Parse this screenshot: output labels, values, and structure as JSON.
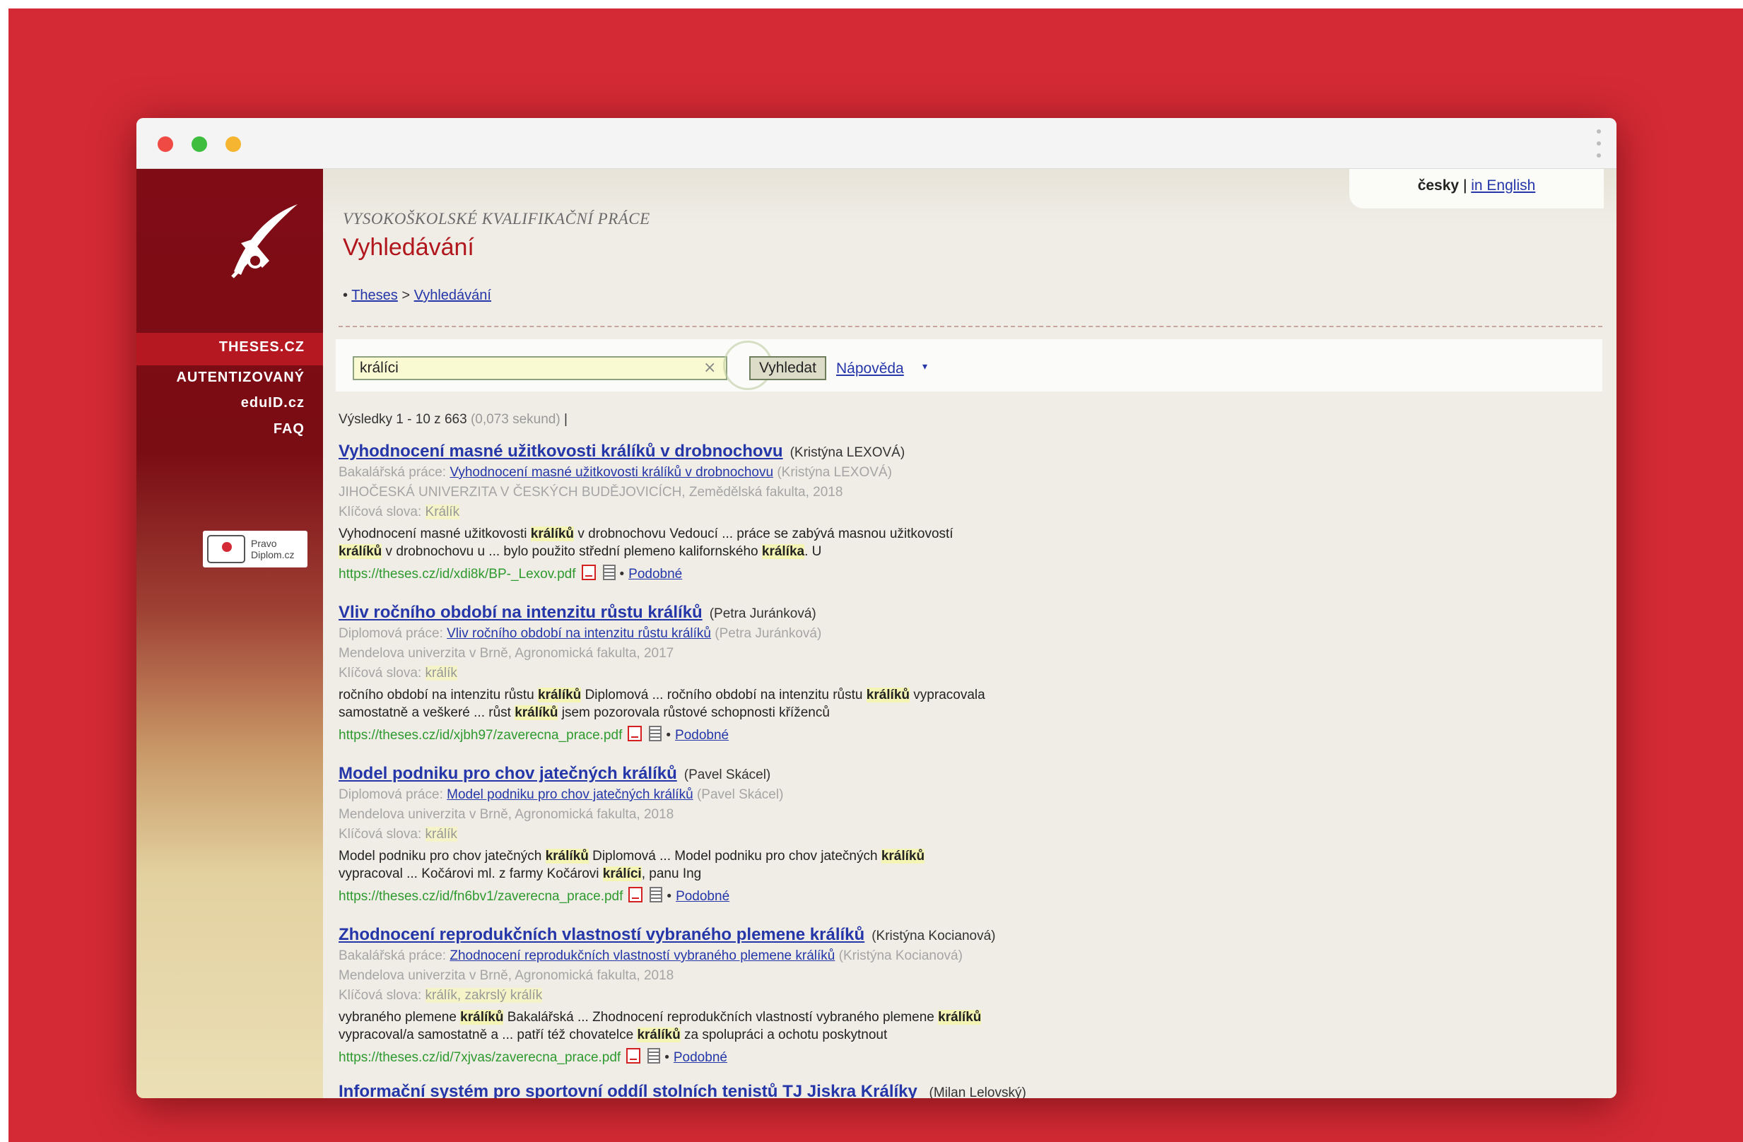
{
  "colors": {
    "background": "#d42a35",
    "sidebar_top": "#800c16",
    "accent": "#b1161d",
    "link": "#2436a8",
    "url": "#2f9a2f"
  },
  "lang": {
    "current": "česky",
    "separator": "|",
    "english": "in English"
  },
  "header": {
    "subtitle": "VYSOKOŠKOLSKÉ KVALIFIKAČNÍ PRÁCE",
    "title": "Vyhledávání"
  },
  "breadcrumb": {
    "bullet": "•",
    "home": "Theses",
    "sep": ">",
    "current": "Vyhledávání"
  },
  "sidebar": {
    "items": [
      {
        "label": "THESES.CZ",
        "active": true
      },
      {
        "label": "AUTENTIZOVANÝ"
      },
      {
        "label": "eduID.cz"
      },
      {
        "label": "FAQ"
      }
    ],
    "badge": {
      "line1": "Pravo",
      "line2": "Diplom.cz"
    }
  },
  "search": {
    "value": "králíci",
    "clear": "×",
    "button": "Vyhledat",
    "help": "Nápověda",
    "help_arrow": "▾"
  },
  "stats": {
    "text": "Výsledky 1 - 10 z 663",
    "time": "(0,073 sekund)",
    "tail": "|"
  },
  "results": [
    {
      "title": "Vyhodnocení masné užitkovosti králíků v drobnochovu",
      "author": "(Kristýna LEXOVÁ)",
      "type": "Bakalářská práce:",
      "type_link": "Vyhodnocení masné užitkovosti králíků v drobnochovu",
      "type_author": "(Kristýna LEXOVÁ)",
      "institution": "JIHOČESKÁ UNIVERZITA V ČESKÝCH BUDĚJOVICÍCH, Zemědělská fakulta, 2018",
      "keywords_label": "Klíčová slova:",
      "keywords": "Králík",
      "snippet1": "Vyhodnocení masné užitkovosti <b>králíků</b> v drobnochovu Vedoucí ... práce se zabývá masnou užitkovostí",
      "snippet2": "<b>králíků</b> v drobnochovu u ... bylo použito střední plemeno kalifornského <b>králíka</b>. U",
      "url": "https://theses.cz/id/xdi8k/BP-_Lexov.pdf",
      "similar": "Podobné"
    },
    {
      "title": "Vliv ročního období na intenzitu růstu králíků",
      "author": "(Petra Juránková)",
      "type": "Diplomová práce:",
      "type_link": "Vliv ročního období na intenzitu růstu králíků",
      "type_author": "(Petra Juránková)",
      "institution": "Mendelova univerzita v Brně, Agronomická fakulta, 2017",
      "keywords_label": "Klíčová slova:",
      "keywords": "králík",
      "snippet1": "ročního období na intenzitu růstu <b>králíků</b> Diplomová ... ročního období na intenzitu růstu <b>králíků</b> vypracovala",
      "snippet2": "samostatně a veškeré ... růst <b>králíků</b> jsem pozorovala růstové schopnosti kříženců",
      "url": "https://theses.cz/id/xjbh97/zaverecna_prace.pdf",
      "similar": "Podobné"
    },
    {
      "title": "Model podniku pro chov jatečných králíků",
      "author": "(Pavel Skácel)",
      "type": "Diplomová práce:",
      "type_link": "Model podniku pro chov jatečných králíků",
      "type_author": "(Pavel Skácel)",
      "institution": "Mendelova univerzita v Brně, Agronomická fakulta, 2018",
      "keywords_label": "Klíčová slova:",
      "keywords": "králík",
      "snippet1": "Model podniku pro chov jatečných <b>králíků</b> Diplomová ... Model podniku pro chov jatečných <b>králíků</b>",
      "snippet2": "vypracoval ... Kočárovi ml. z farmy Kočárovi <b>králíci</b>, panu Ing",
      "url": "https://theses.cz/id/fn6bv1/zaverecna_prace.pdf",
      "similar": "Podobné"
    },
    {
      "title": "Zhodnocení reprodukčních vlastností vybraného plemene králíků",
      "author": "(Kristýna Kocianová)",
      "type": "Bakalářská práce:",
      "type_link": "Zhodnocení reprodukčních vlastností vybraného plemene králíků",
      "type_author": "(Kristýna Kocianová)",
      "institution": "Mendelova univerzita v Brně, Agronomická fakulta, 2018",
      "keywords_label": "Klíčová slova:",
      "keywords": "králík, zakrslý králík",
      "snippet1": "vybraného plemene <b>králíků</b> Bakalářská ... Zhodnocení reprodukčních vlastností vybraného plemene <b>králíků</b>",
      "snippet2": "vypracoval/a samostatně a ... patří též chovatelce <b>králíků</b> za spolupráci a ochotu poskytnout",
      "url": "https://theses.cz/id/7xjvas/zaverecna_prace.pdf",
      "similar": "Podobné"
    }
  ],
  "partial_result": {
    "title": "Informační systém pro sportovní oddíl stolních tenistů TJ Jiskra Králíky",
    "author": "(Milan Lelovský)"
  }
}
